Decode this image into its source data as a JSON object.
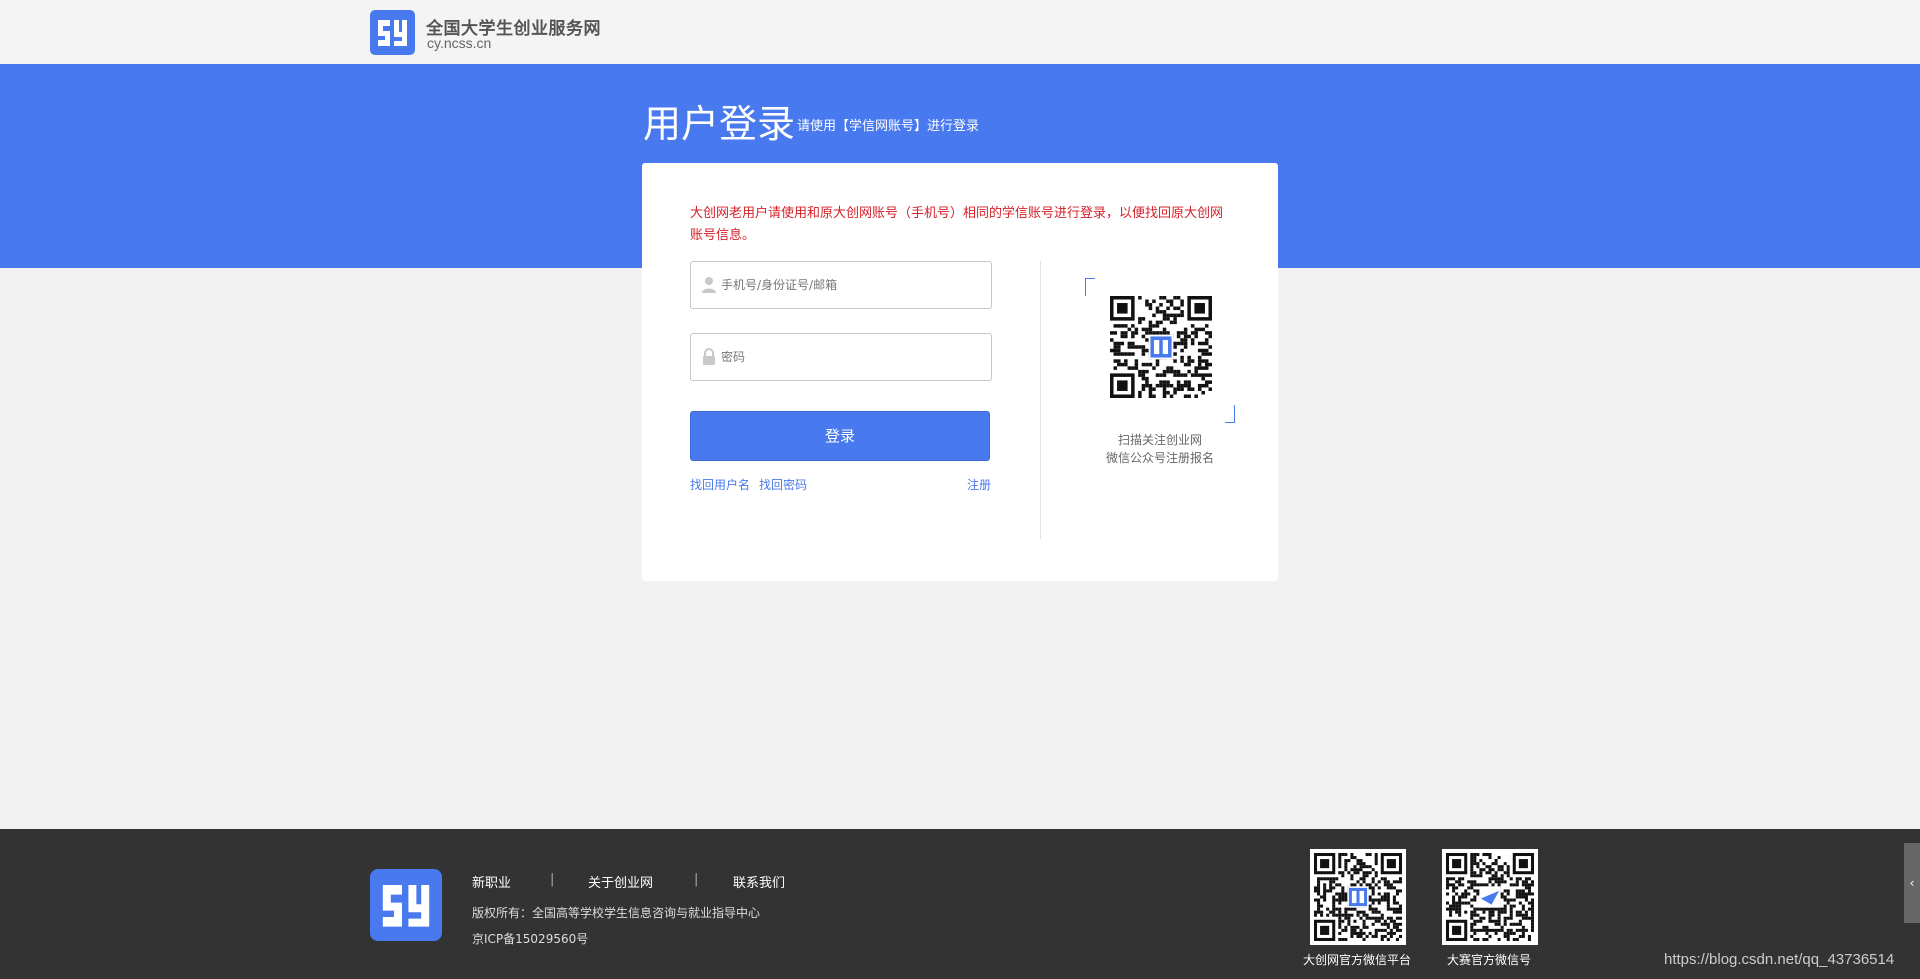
{
  "header": {
    "site_title": "全国大学生创业服务网",
    "site_domain": "cy.ncss.cn"
  },
  "banner": {
    "title": "用户登录",
    "subtitle": "请使用【学信网账号】进行登录"
  },
  "login": {
    "notice": "大创网老用户请使用和原大创网账号（手机号）相同的学信账号进行登录，以便找回原大创网账号信息。",
    "username_placeholder": "手机号/身份证号/邮箱",
    "username_value": "",
    "password_placeholder": "密码",
    "password_value": "",
    "submit_label": "登录",
    "find_username_label": "找回用户名",
    "find_password_label": "找回密码",
    "register_label": "注册",
    "qr_caption_line1": "扫描关注创业网",
    "qr_caption_line2": "微信公众号注册报名"
  },
  "footer": {
    "nav": [
      "新职业",
      "关于创业网",
      "联系我们"
    ],
    "separator": "|",
    "copyright": "版权所有：全国高等学校学生信息咨询与就业指导中心",
    "icp": "京ICP备15029560号",
    "qr_labels": [
      "大创网官方微信平台",
      "大赛官方微信号"
    ],
    "side_tab": "‹"
  },
  "watermark": "https://blog.csdn.net/qq_43736514",
  "colors": {
    "brand_blue": "#4879ee",
    "notice_red": "#d6202a",
    "footer_bg": "#333333",
    "page_bg": "#f2f2f2"
  },
  "icons": {
    "logo": "cy-logo-icon",
    "user": "user-icon",
    "lock": "lock-icon",
    "qr": "qr-code-icon"
  }
}
